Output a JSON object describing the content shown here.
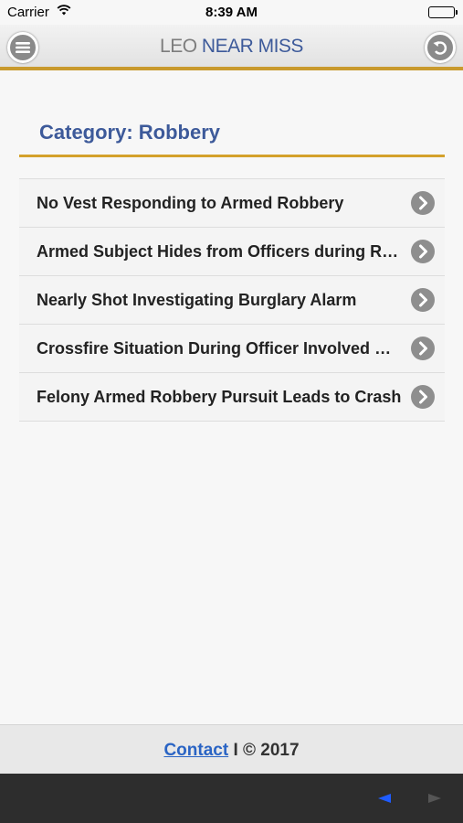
{
  "status_bar": {
    "carrier": "Carrier",
    "time": "8:39 AM"
  },
  "header": {
    "title_part1": "LEO ",
    "title_part2": "NEAR MISS"
  },
  "category": {
    "label": "Category: Robbery"
  },
  "list": [
    {
      "text": "No Vest Responding to Armed Robbery"
    },
    {
      "text": "Armed Subject Hides from Officers during Robbery Response"
    },
    {
      "text": "Nearly Shot Investigating Burglary Alarm"
    },
    {
      "text": "Crossfire Situation During Officer Involved Shooting"
    },
    {
      "text": "Felony Armed Robbery Pursuit Leads to Crash"
    }
  ],
  "footer": {
    "contact": "Contact",
    "copyright": " I © 2017"
  },
  "colors": {
    "accent_gold": "#c99a2e",
    "brand_blue": "#3d5a9a",
    "link_blue": "#2a64c4",
    "nav_active": "#1f5cff",
    "nav_inactive": "#555555"
  },
  "icons": {
    "menu": "hamburger-icon",
    "back": "undo-icon",
    "item_arrow": "chevron-right-icon",
    "prev": "triangle-left-icon",
    "next": "triangle-right-icon"
  }
}
